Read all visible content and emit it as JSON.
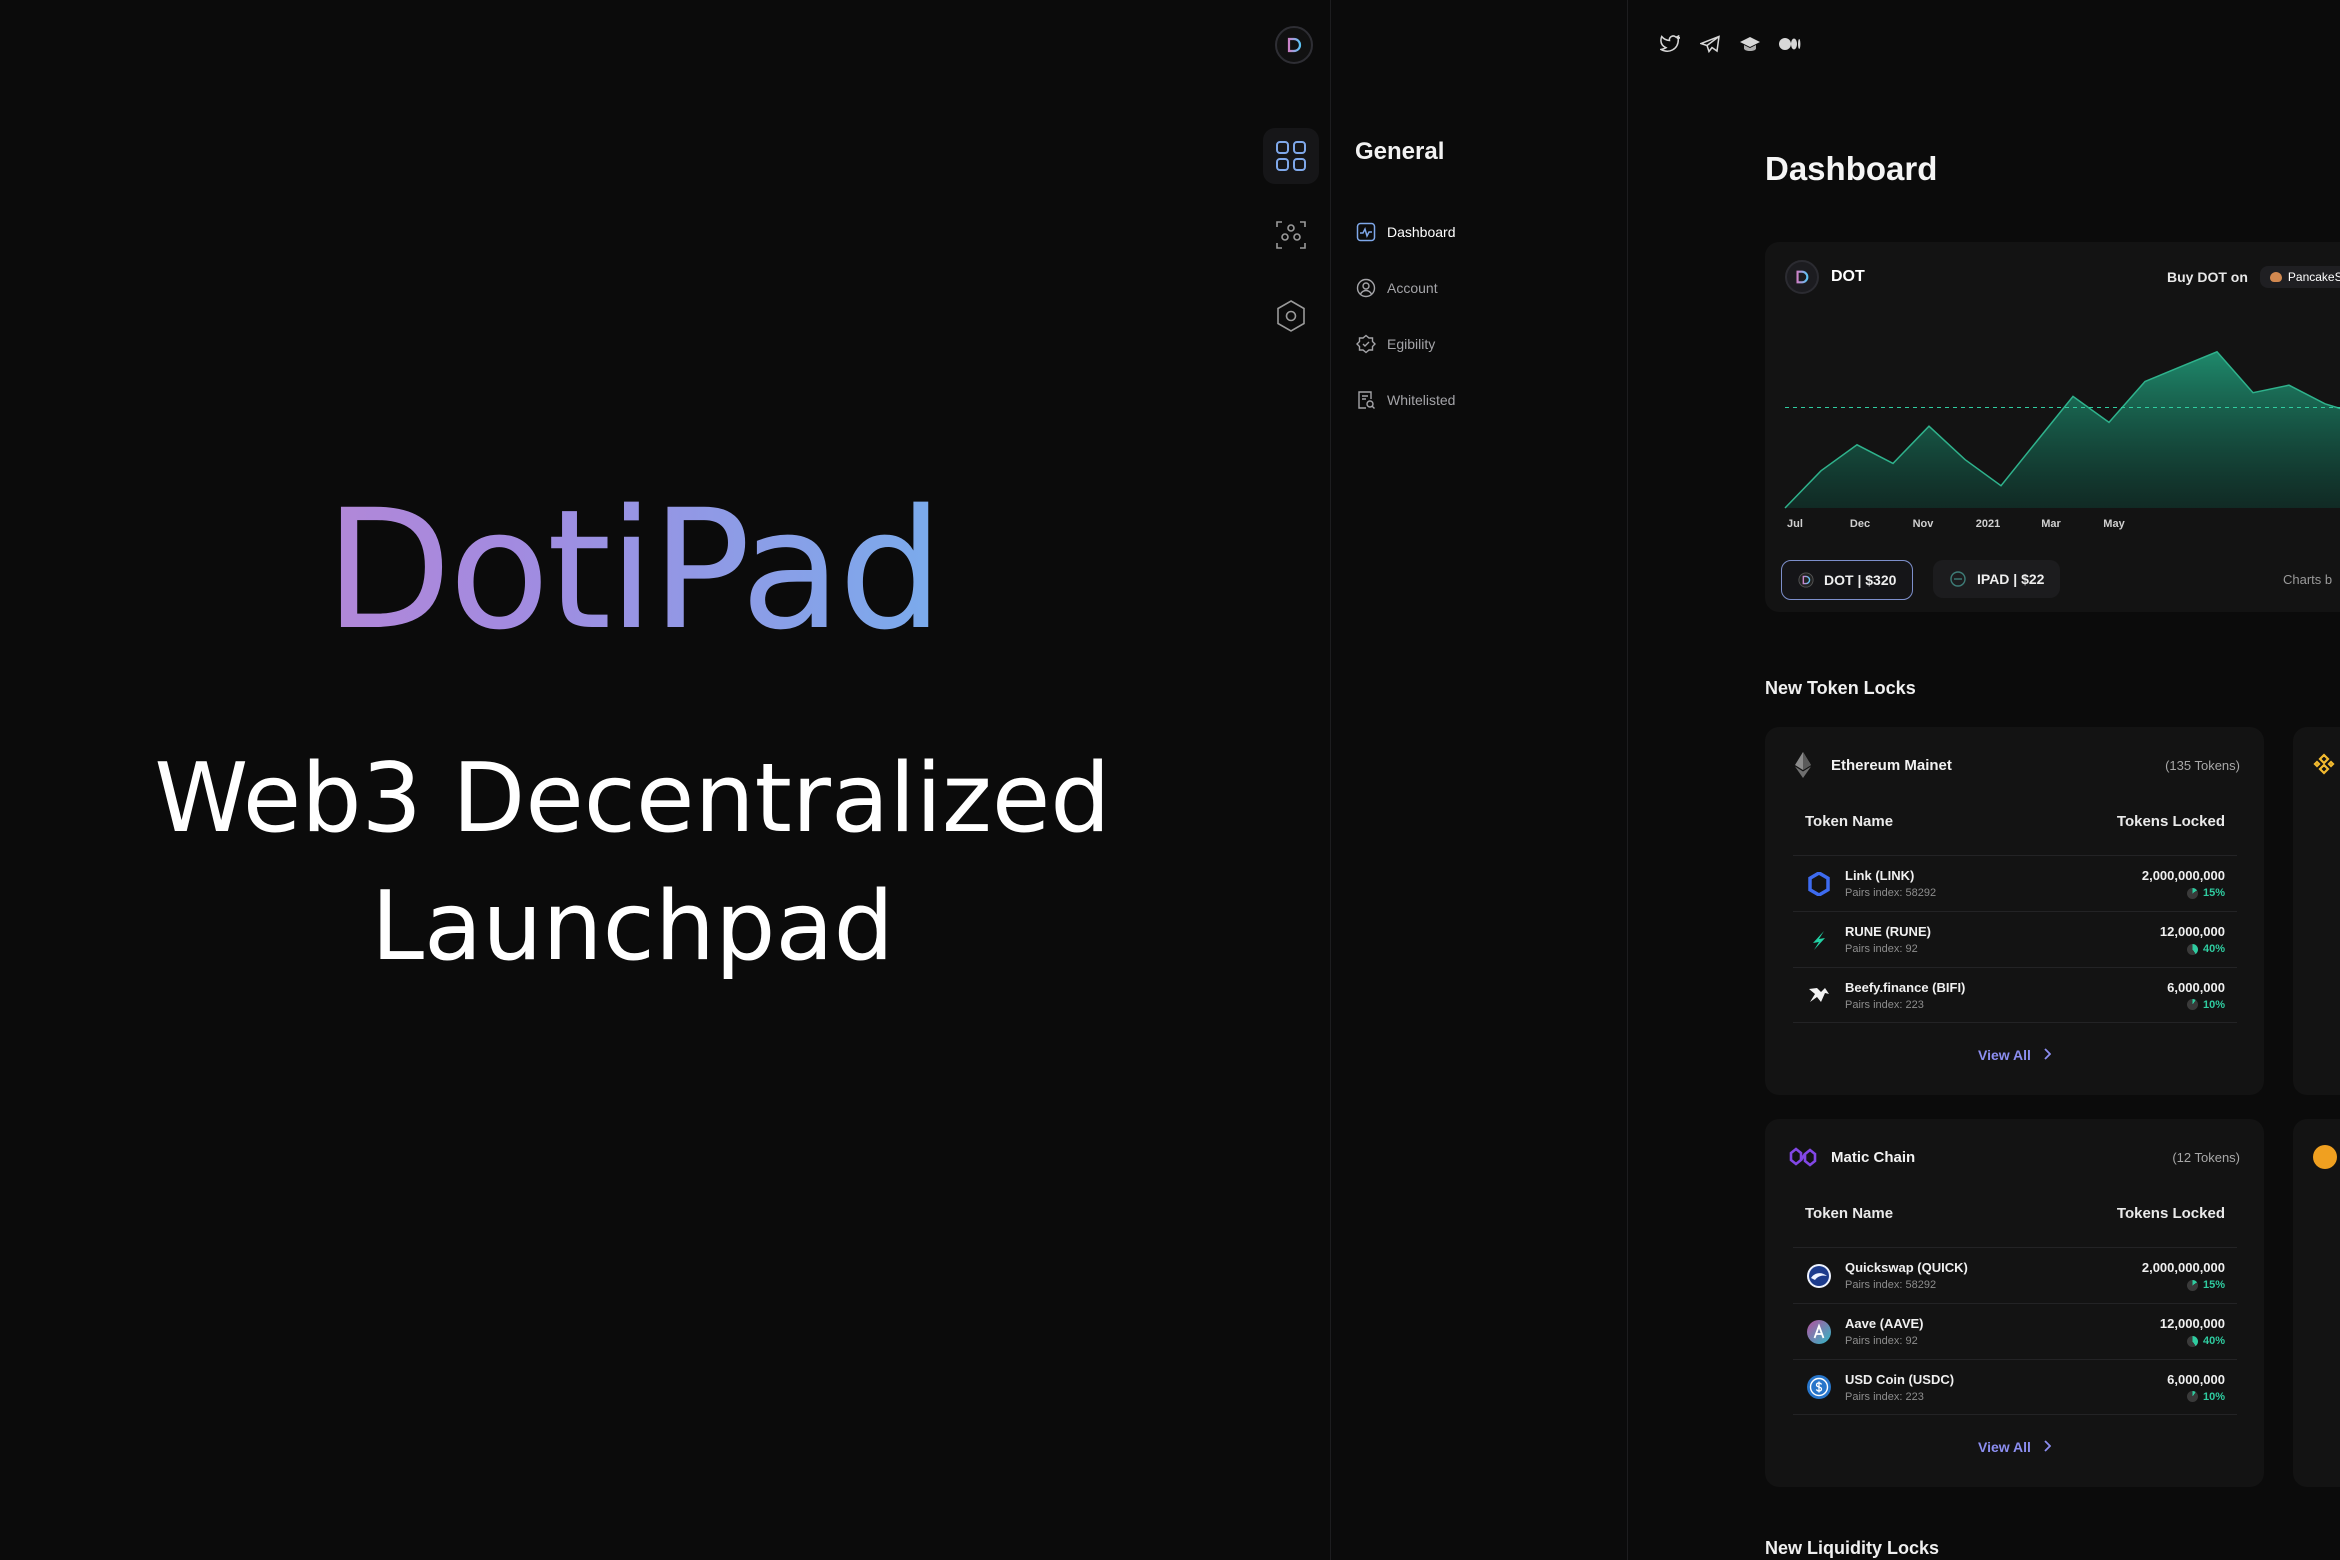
{
  "hero": {
    "brand": "DotiPad",
    "tagline_line1": "Web3 Decentralized",
    "tagline_line2": "Launchpad"
  },
  "rail": {
    "icons": [
      "dotipad-logo-icon",
      "grid-icon",
      "network-icon",
      "hexagon-settings-icon"
    ]
  },
  "nav": {
    "title": "General",
    "items": [
      {
        "label": "Dashboard",
        "icon": "chart-icon",
        "active": true
      },
      {
        "label": "Account",
        "icon": "user-icon",
        "active": false
      },
      {
        "label": "Egibility",
        "icon": "check-shield-icon",
        "active": false
      },
      {
        "label": "Whitelisted",
        "icon": "document-search-icon",
        "active": false
      }
    ]
  },
  "social": [
    "twitter-icon",
    "telegram-icon",
    "graduation-cap-icon",
    "medium-icon"
  ],
  "main": {
    "title": "Dashboard",
    "chart_card": {
      "token": "DOT",
      "buy_text": "Buy DOT on",
      "exchange": "PancakeSw",
      "pill_dot": "DOT | $320",
      "pill_ipad": "IPAD | $22",
      "charts_by": "Charts b"
    },
    "new_token_locks": "New Token Locks",
    "new_liquidity_locks": "New Liquidity Locks",
    "lock_cards": [
      {
        "chain": "Ethereum Mainet",
        "count": "(135 Tokens)",
        "col_token": "Token Name",
        "col_locked": "Tokens Locked",
        "view_all": "View All",
        "rows": [
          {
            "name": "Link (LINK)",
            "pairs": "Pairs index: 58292",
            "amount": "2,000,000,000",
            "pct": "15%"
          },
          {
            "name": "RUNE (RUNE)",
            "pairs": "Pairs index: 92",
            "amount": "12,000,000",
            "pct": "40%"
          },
          {
            "name": "Beefy.finance (BIFI)",
            "pairs": "Pairs index: 223",
            "amount": "6,000,000",
            "pct": "10%"
          }
        ]
      },
      {
        "chain": "Matic Chain",
        "count": "(12 Tokens)",
        "col_token": "Token Name",
        "col_locked": "Tokens Locked",
        "view_all": "View All",
        "rows": [
          {
            "name": "Quickswap (QUICK)",
            "pairs": "Pairs index: 58292",
            "amount": "2,000,000,000",
            "pct": "15%"
          },
          {
            "name": "Aave (AAVE)",
            "pairs": "Pairs index: 92",
            "amount": "12,000,000",
            "pct": "40%"
          },
          {
            "name": "USD Coin (USDC)",
            "pairs": "Pairs index: 223",
            "amount": "6,000,000",
            "pct": "10%"
          }
        ]
      }
    ]
  },
  "colors": {
    "background": "#0b0b0b",
    "card": "#131313",
    "accent_green": "#2fcca0",
    "link_purple": "#8c8ef0",
    "brand_gradient_start": "#cd83c8",
    "brand_gradient_end": "#5bc4f5"
  },
  "chart_data": {
    "type": "area",
    "x_labels": [
      "Jul",
      "Dec",
      "Nov",
      "2021",
      "Mar",
      "May"
    ],
    "values": [
      0,
      10,
      17,
      12,
      22,
      13,
      6,
      18,
      30,
      23,
      34,
      38,
      42,
      31,
      33,
      28,
      25,
      22,
      20
    ],
    "reference_line": 27,
    "ylim": [
      0,
      50
    ],
    "grid": false
  }
}
